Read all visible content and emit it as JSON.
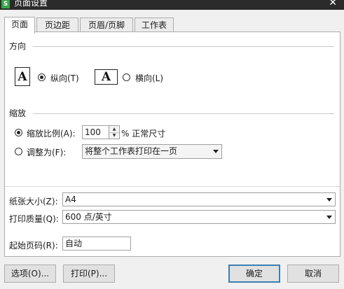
{
  "window": {
    "title": "页面设置",
    "app_icon_letter": "S",
    "close_glyph": "✕"
  },
  "tabs": [
    "页面",
    "页边距",
    "页眉/页脚",
    "工作表"
  ],
  "orientation": {
    "group_label": "方向",
    "page_icon_letter": "A",
    "portrait_label": "纵向(T)",
    "landscape_label": "横向(L)",
    "selected": "portrait"
  },
  "scaling": {
    "group_label": "缩放",
    "scale_label": "缩放比例(A):",
    "scale_value": "100",
    "scale_suffix": "% 正常尺寸",
    "fit_label": "调整为(F):",
    "fit_option": "将整个工作表打印在一页",
    "selected": "scale"
  },
  "paper": {
    "label": "纸张大小(Z):",
    "value": "A4"
  },
  "quality": {
    "label": "打印质量(Q):",
    "value": "600 点/英寸"
  },
  "first_page": {
    "label": "起始页码(R):",
    "value": "自动"
  },
  "buttons": {
    "options": "选项(O)...",
    "print": "打印(P)...",
    "ok": "确定",
    "cancel": "取消"
  },
  "colors": {
    "titlebar": "#2b2b2b",
    "default_button_border": "#3c7fb1",
    "app_icon": "#3aa24a"
  }
}
